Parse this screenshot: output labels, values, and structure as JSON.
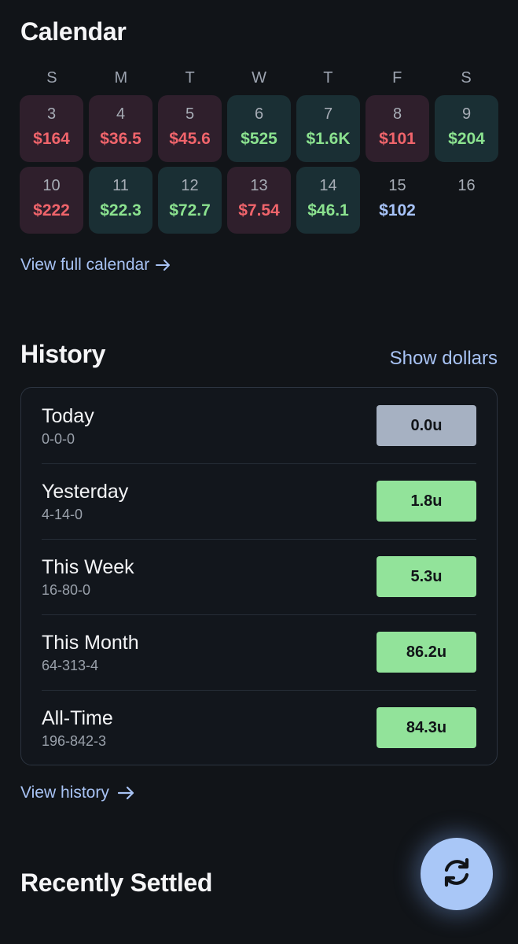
{
  "calendar": {
    "title": "Calendar",
    "weekdays": [
      "S",
      "M",
      "T",
      "W",
      "T",
      "F",
      "S"
    ],
    "days": [
      {
        "day": "3",
        "amount": "$164",
        "status": "loss"
      },
      {
        "day": "4",
        "amount": "$36.5",
        "status": "loss"
      },
      {
        "day": "5",
        "amount": "$45.6",
        "status": "loss"
      },
      {
        "day": "6",
        "amount": "$525",
        "status": "win"
      },
      {
        "day": "7",
        "amount": "$1.6K",
        "status": "win"
      },
      {
        "day": "8",
        "amount": "$101",
        "status": "loss"
      },
      {
        "day": "9",
        "amount": "$204",
        "status": "win"
      },
      {
        "day": "10",
        "amount": "$222",
        "status": "loss"
      },
      {
        "day": "11",
        "amount": "$22.3",
        "status": "win"
      },
      {
        "day": "12",
        "amount": "$72.7",
        "status": "win"
      },
      {
        "day": "13",
        "amount": "$7.54",
        "status": "loss"
      },
      {
        "day": "14",
        "amount": "$46.1",
        "status": "win"
      },
      {
        "day": "15",
        "amount": "$102",
        "status": "pending"
      },
      {
        "day": "16",
        "amount": "",
        "status": "pending"
      }
    ],
    "view_link": "View full calendar",
    "colors": {
      "loss": "#f0646b",
      "win": "#8be28f",
      "pending": "#a7c3f8"
    }
  },
  "history": {
    "title": "History",
    "toggle": "Show dollars",
    "rows": [
      {
        "label": "Today",
        "record": "0-0-0",
        "units": "0.0u",
        "tone": "neutral"
      },
      {
        "label": "Yesterday",
        "record": "4-14-0",
        "units": "1.8u",
        "tone": "positive"
      },
      {
        "label": "This Week",
        "record": "16-80-0",
        "units": "5.3u",
        "tone": "positive"
      },
      {
        "label": "This Month",
        "record": "64-313-4",
        "units": "86.2u",
        "tone": "positive"
      },
      {
        "label": "All-Time",
        "record": "196-842-3",
        "units": "84.3u",
        "tone": "positive"
      }
    ],
    "view_link": "View history"
  },
  "recently_settled": {
    "title": "Recently Settled"
  },
  "fab": {
    "icon": "refresh-icon"
  }
}
